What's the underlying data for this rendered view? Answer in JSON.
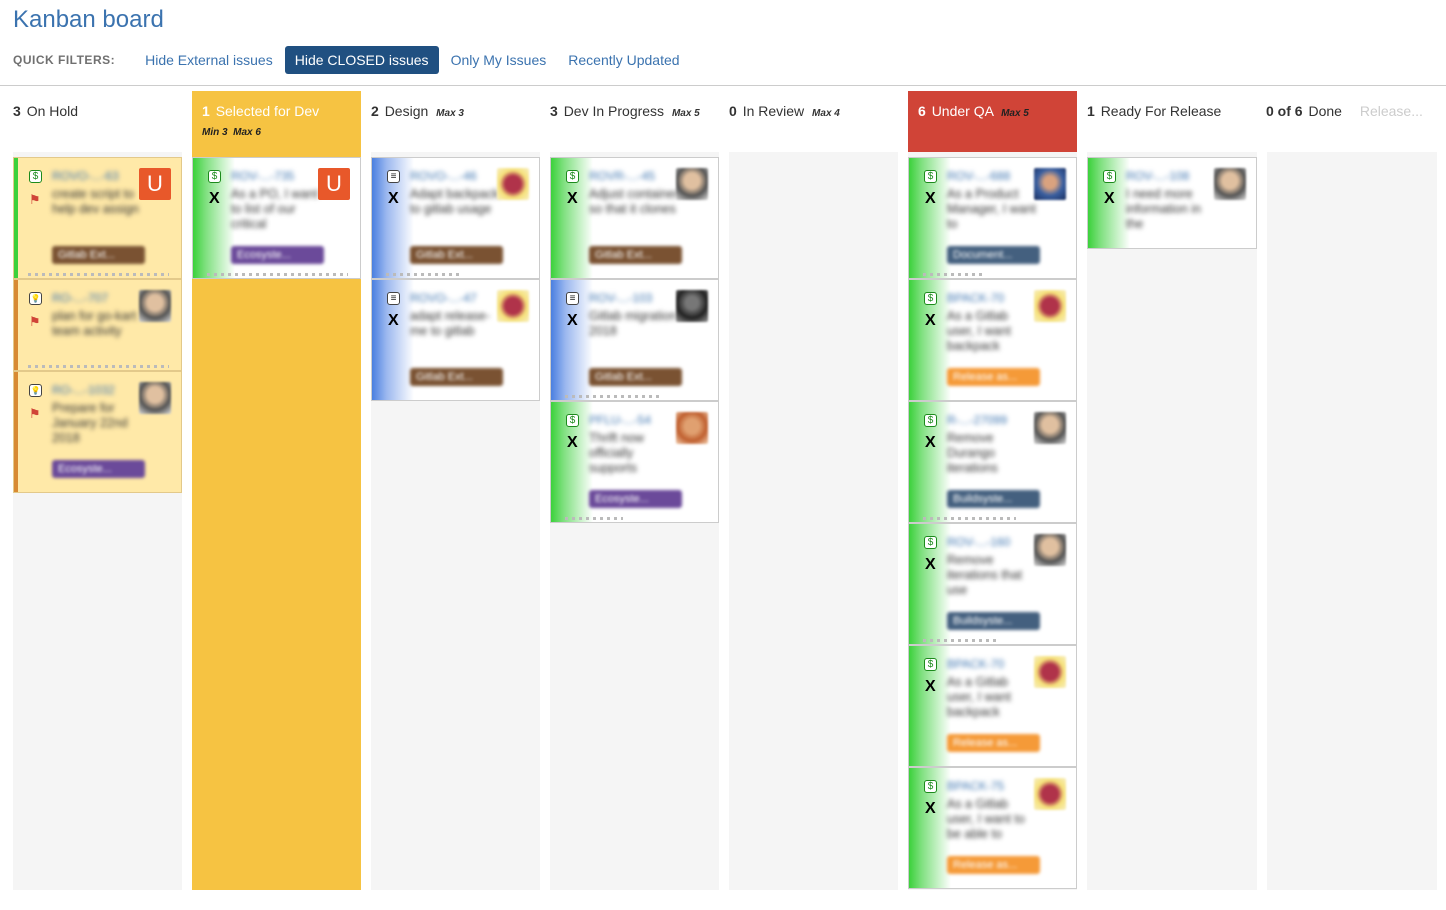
{
  "board": {
    "title": "Kanban board",
    "quick_filters_label": "QUICK FILTERS:",
    "filters": [
      {
        "label": "Hide External issues",
        "active": false
      },
      {
        "label": "Hide CLOSED issues",
        "active": true
      },
      {
        "label": "Only My Issues",
        "active": false
      },
      {
        "label": "Recently Updated",
        "active": false
      }
    ]
  },
  "columns": [
    {
      "count": "3",
      "name": "On Hold",
      "max": "",
      "min": ""
    },
    {
      "count": "1",
      "name": "Selected for Dev",
      "min": "Min 3",
      "max": "Max 6"
    },
    {
      "count": "2",
      "name": "Design",
      "max": "Max 3"
    },
    {
      "count": "3",
      "name": "Dev In Progress",
      "max": "Max 5"
    },
    {
      "count": "0",
      "name": "In Review",
      "max": "Max 4"
    },
    {
      "count": "6",
      "name": "Under QA",
      "max": "Max 5"
    },
    {
      "count": "1",
      "name": "Ready For Release",
      "max": ""
    },
    {
      "count": "0 of 6",
      "name": "Done",
      "extra": "Release..."
    }
  ],
  "cards": {
    "c1": {
      "key": "ROVO-...-63",
      "summary": "create script to help dev assign",
      "epic": "Gitlab Ext..."
    },
    "c2": {
      "key": "RO-...-707",
      "summary": "plan for go-kart team activity",
      "epic": ""
    },
    "c3": {
      "key": "RO-...-1032",
      "summary": "Prepare for January 22nd 2018",
      "epic": "Ecosyste..."
    },
    "c4": {
      "key": "ROV-...-735",
      "summary": "As a PO, I want to list of our critical",
      "epic": "Ecosyste..."
    },
    "c5": {
      "key": "ROVO-...-46",
      "summary": "Adapt backpack to gitlab usage",
      "epic": "Gitlab Ext..."
    },
    "c6": {
      "key": "ROVO-...-47",
      "summary": "adapt release-me to gitlab",
      "epic": "Gitlab Ext..."
    },
    "c7": {
      "key": "ROVR-...-45",
      "summary": "Adjust container so that it clones",
      "epic": "Gitlab Ext..."
    },
    "c8": {
      "key": "ROV-...-103",
      "summary": "Gitlab migration 2018",
      "epic": "Gitlab Ext..."
    },
    "c9": {
      "key": "PFLU-...-54",
      "summary": "Thrift now officially supports",
      "epic": "Ecosyste..."
    },
    "c10": {
      "key": "ROV-...-688",
      "summary": "As a Product Manager, I want to",
      "epic": "Document..."
    },
    "c11": {
      "key": "BPACK-70",
      "summary": "As a Gitlab user, I want backpack",
      "epic": "Release as..."
    },
    "c12": {
      "key": "R-...-27099",
      "summary": "Remove Durango iterations",
      "epic": "Buildsyste..."
    },
    "c13": {
      "key": "ROV-...-160",
      "summary": "Remove iterations that use",
      "epic": "Buildsyste..."
    },
    "c14": {
      "key": "BPACK-70",
      "summary": "As a Gitlab user, I want backpack",
      "epic": "Release as..."
    },
    "c15": {
      "key": "BPACK-75",
      "summary": "As a Gitlab user, I want to be able to",
      "epic": "Release as..."
    },
    "c16": {
      "key": "ROV-...-108",
      "summary": "I need more information in the",
      "epic": ""
    }
  },
  "icons": {
    "x_mark": "X",
    "avatar_letter": "U",
    "story_icon": "$",
    "task_icon": "≡",
    "idea_icon": "💡",
    "flag_icon": "⚑"
  },
  "colors": {
    "accent": "#3b73af",
    "selected_column": "#f6c342",
    "over_limit": "#d04437",
    "active_filter": "#205081",
    "epic_brown": "#7a5232",
    "epic_purple": "#6b4a9a",
    "epic_slate": "#44607f",
    "epic_orange": "#f59a38"
  }
}
